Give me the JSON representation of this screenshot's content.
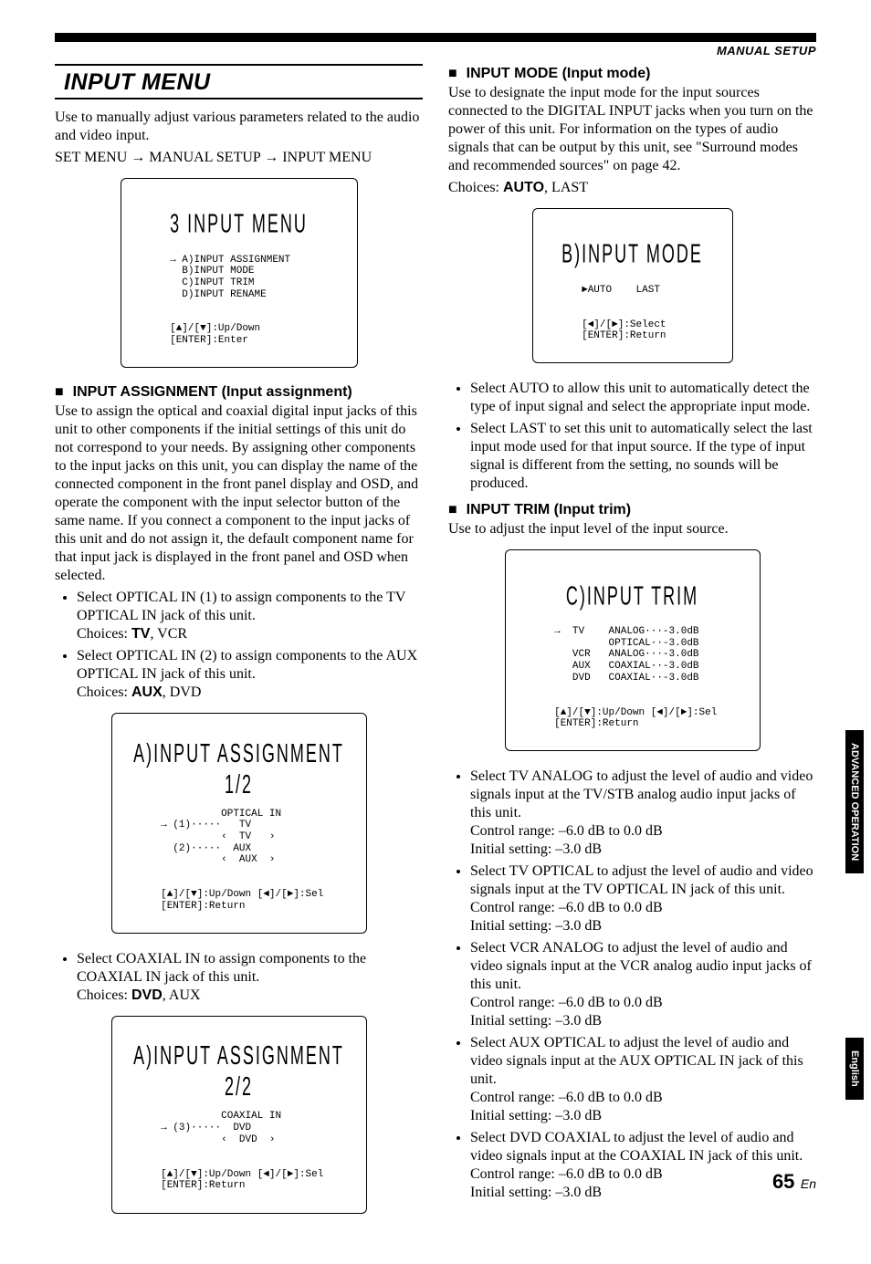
{
  "header": {
    "rule_label": "MANUAL SETUP"
  },
  "left": {
    "title": "INPUT MENU",
    "intro1": "Use to manually adjust various parameters related to the audio and video input.",
    "path": "SET MENU → MANUAL SETUP → INPUT MENU",
    "osd1": {
      "title": "3 INPUT MENU",
      "l1": "→ A)INPUT ASSIGNMENT",
      "l2": "  B)INPUT MODE",
      "l3": "  C)INPUT TRIM",
      "l4": "  D)INPUT RENAME",
      "nav1": "[▲]/[▼]:Up/Down",
      "nav2": "[ENTER]:Enter"
    },
    "h_assign": "INPUT ASSIGNMENT (Input assignment)",
    "assign_body": "Use to assign the optical and coaxial digital input jacks of this unit to other components if the initial settings of this unit do not correspond to your needs. By assigning other components to the input jacks on this unit, you can display the name of the connected component in the front panel display and OSD, and operate the component with the input selector button of the same name. If you connect a component to the input jacks of this unit and do not assign it, the default component name for that input jack is displayed in the front panel and OSD when selected.",
    "assign_b1a": "Select OPTICAL IN (1) to assign components to the TV OPTICAL IN jack of this unit.",
    "assign_b1b_pre": "Choices: ",
    "assign_b1b_bold": "TV",
    "assign_b1b_post": ", VCR",
    "assign_b2a": "Select OPTICAL IN (2) to assign components to the AUX OPTICAL IN jack of this unit.",
    "assign_b2b_pre": "Choices: ",
    "assign_b2b_bold": "AUX",
    "assign_b2b_post": ", DVD",
    "osd2": {
      "title": "A)INPUT ASSIGNMENT 1/2",
      "sub": "          OPTICAL IN",
      "l1": "→ (1)·····   TV",
      "l2": "          ‹  TV   ›",
      "l3": "  (2)·····  AUX",
      "l4": "          ‹  AUX  ›",
      "nav1": "[▲]/[▼]:Up/Down [◄]/[►]:Sel",
      "nav2": "[ENTER]:Return"
    },
    "assign_b3a": "Select COAXIAL IN to assign components to the COAXIAL IN jack of this unit.",
    "assign_b3b_pre": "Choices: ",
    "assign_b3b_bold": "DVD",
    "assign_b3b_post": ", AUX",
    "osd3": {
      "title": "A)INPUT ASSIGNMENT 2/2",
      "sub": "          COAXIAL IN",
      "l1": "→ (3)·····  DVD",
      "l2": "          ‹  DVD  ›",
      "nav1": "[▲]/[▼]:Up/Down [◄]/[►]:Sel",
      "nav2": "[ENTER]:Return"
    }
  },
  "right": {
    "h_mode": "INPUT MODE (Input mode)",
    "mode_body": "Use to designate the input mode for the input sources connected to the DIGITAL INPUT jacks when you turn on the power of this unit. For information on the types of audio signals that can be output by this unit, see \"Surround modes and recommended sources\" on page 42.",
    "mode_choices_pre": "Choices: ",
    "mode_choices_bold": "AUTO",
    "mode_choices_post": ", LAST",
    "osd_mode": {
      "title": "B)INPUT MODE",
      "l1": "►AUTO    LAST",
      "nav1": "[◄]/[►]:Select",
      "nav2": "[ENTER]:Return"
    },
    "mode_b1": "Select AUTO to allow this unit to automatically detect the type of input signal and select the appropriate input mode.",
    "mode_b2": "Select LAST to set this unit to automatically select the last input mode used for that input source. If the type of input signal is different from the setting, no sounds will be produced.",
    "h_trim": "INPUT TRIM (Input trim)",
    "trim_body": "Use to adjust the input level of the input source.",
    "osd_trim": {
      "title": "C)INPUT TRIM",
      "l1": "→  TV    ANALOG···-3.0dB",
      "l2": "         OPTICAL··-3.0dB",
      "l3": "   VCR   ANALOG···-3.0dB",
      "l4": "   AUX   COAXIAL··-3.0dB",
      "l5": "   DVD   COAXIAL··-3.0dB",
      "nav1": "[▲]/[▼]:Up/Down [◄]/[►]:Sel",
      "nav2": "[ENTER]:Return"
    },
    "trim_b1a": "Select TV ANALOG to adjust the level of audio and video signals input at the TV/STB analog audio input jacks of this unit.",
    "range": "Control range: –6.0 dB to 0.0 dB",
    "initial": "Initial setting: –3.0 dB",
    "trim_b2a": "Select TV OPTICAL to adjust the level of audio and video signals input at the TV OPTICAL IN jack of this unit.",
    "trim_b3a": "Select VCR ANALOG to adjust the level of audio and video signals input at the VCR analog audio input jacks of this unit.",
    "trim_b4a": "Select AUX OPTICAL to adjust the level of audio and video signals input at the AUX OPTICAL IN jack of this unit.",
    "trim_b5a": "Select DVD COAXIAL to adjust the level of audio and video signals input at the COAXIAL IN jack of this unit."
  },
  "tabs": {
    "t1": "ADVANCED OPERATION",
    "t2": "English"
  },
  "page": {
    "num": "65",
    "suffix": "En"
  }
}
